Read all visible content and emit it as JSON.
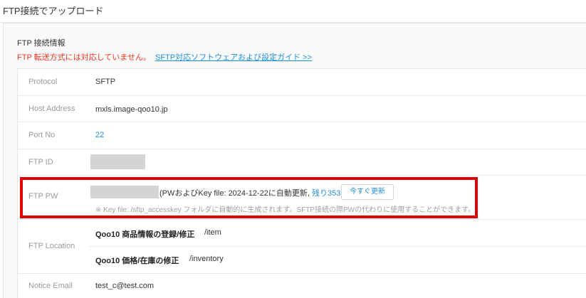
{
  "page": {
    "title": "FTP接続でアップロード"
  },
  "section": {
    "title": "FTP 接続情報",
    "warning": "FTP 転送方式には対応していません。",
    "guide_link": "SFTP対応ソフトウェアおよび設定ガイド >>"
  },
  "rows": {
    "protocol": {
      "label": "Protocol",
      "value": "SFTP"
    },
    "host": {
      "label": "Host Address",
      "value": "mxls.image-qoo10.jp"
    },
    "port": {
      "label": "Port No",
      "value": "22"
    },
    "ftp_id": {
      "label": "FTP ID"
    },
    "ftp_pw": {
      "label": "FTP PW",
      "note_prefix": "(PWおよびKey file: 2024-12-22に自動更新,",
      "remaining": "残り353日",
      "note_suffix": ")",
      "renew_button": "今すぐ更新",
      "help": "※ Key file: /sftp_accesskey フォルダに自動的に生成されます。SFTP接続の際PWの代わりに使用することができます。"
    },
    "ftp_location": {
      "label": "FTP Location",
      "items": [
        {
          "name": "Qoo10 商品情報の登録/修正",
          "path": "/item"
        },
        {
          "name": "Qoo10 価格/在庫の修正",
          "path": "/inventory"
        }
      ]
    },
    "notice_email": {
      "label": "Notice Email",
      "value": "test_c@test.com"
    }
  },
  "colors": {
    "warning": "#f0341d",
    "link": "#1f8fd8",
    "highlight": "#e00000"
  }
}
